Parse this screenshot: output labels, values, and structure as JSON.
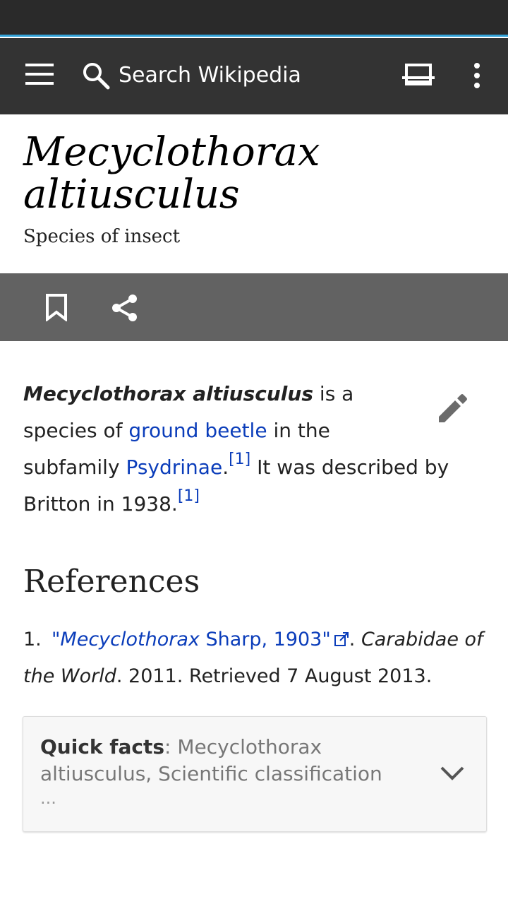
{
  "toolbar": {
    "search_placeholder": "Search Wikipedia",
    "icons": [
      "menu-icon",
      "search-icon",
      "reading-list-icon",
      "overflow-menu-icon"
    ]
  },
  "article": {
    "title": "Mecyclothorax altiusculus",
    "description": "Species of insect"
  },
  "actions": {
    "icons": [
      "bookmark-icon",
      "share-icon"
    ]
  },
  "lead": {
    "name": "Mecyclothorax altiusculus",
    "text1": " is a species of ",
    "link_ground_beetle": "ground beetle",
    "text2": " in the subfamily ",
    "link_psydrinae": "Psydrinae",
    "text3": ".",
    "ref1": "[1]",
    "text4": " It was described by Britton in 1938.",
    "ref2": "[1]"
  },
  "references": {
    "heading": "References",
    "items": [
      {
        "number": "1.",
        "link_open_quote": "\"",
        "link_italic": "Mecyclothorax",
        "link_rest": " Sharp, 1903\"",
        "after_link": ". ",
        "work": "Carabidae of the World",
        "tail": ". 2011. Retrieved 7 August 2013."
      }
    ]
  },
  "quick_facts": {
    "label": "Quick facts",
    "separator": ": ",
    "summary": "Mecyclothorax altiusculus, Scientific classification",
    "more": "..."
  },
  "colors": {
    "toolbar": "#333333",
    "status_bar": "#2a2a2a",
    "status_accent": "#33a3d9",
    "action_bar": "#626262",
    "link": "#0b3dba",
    "icon_gray": "#6b6b6b"
  }
}
